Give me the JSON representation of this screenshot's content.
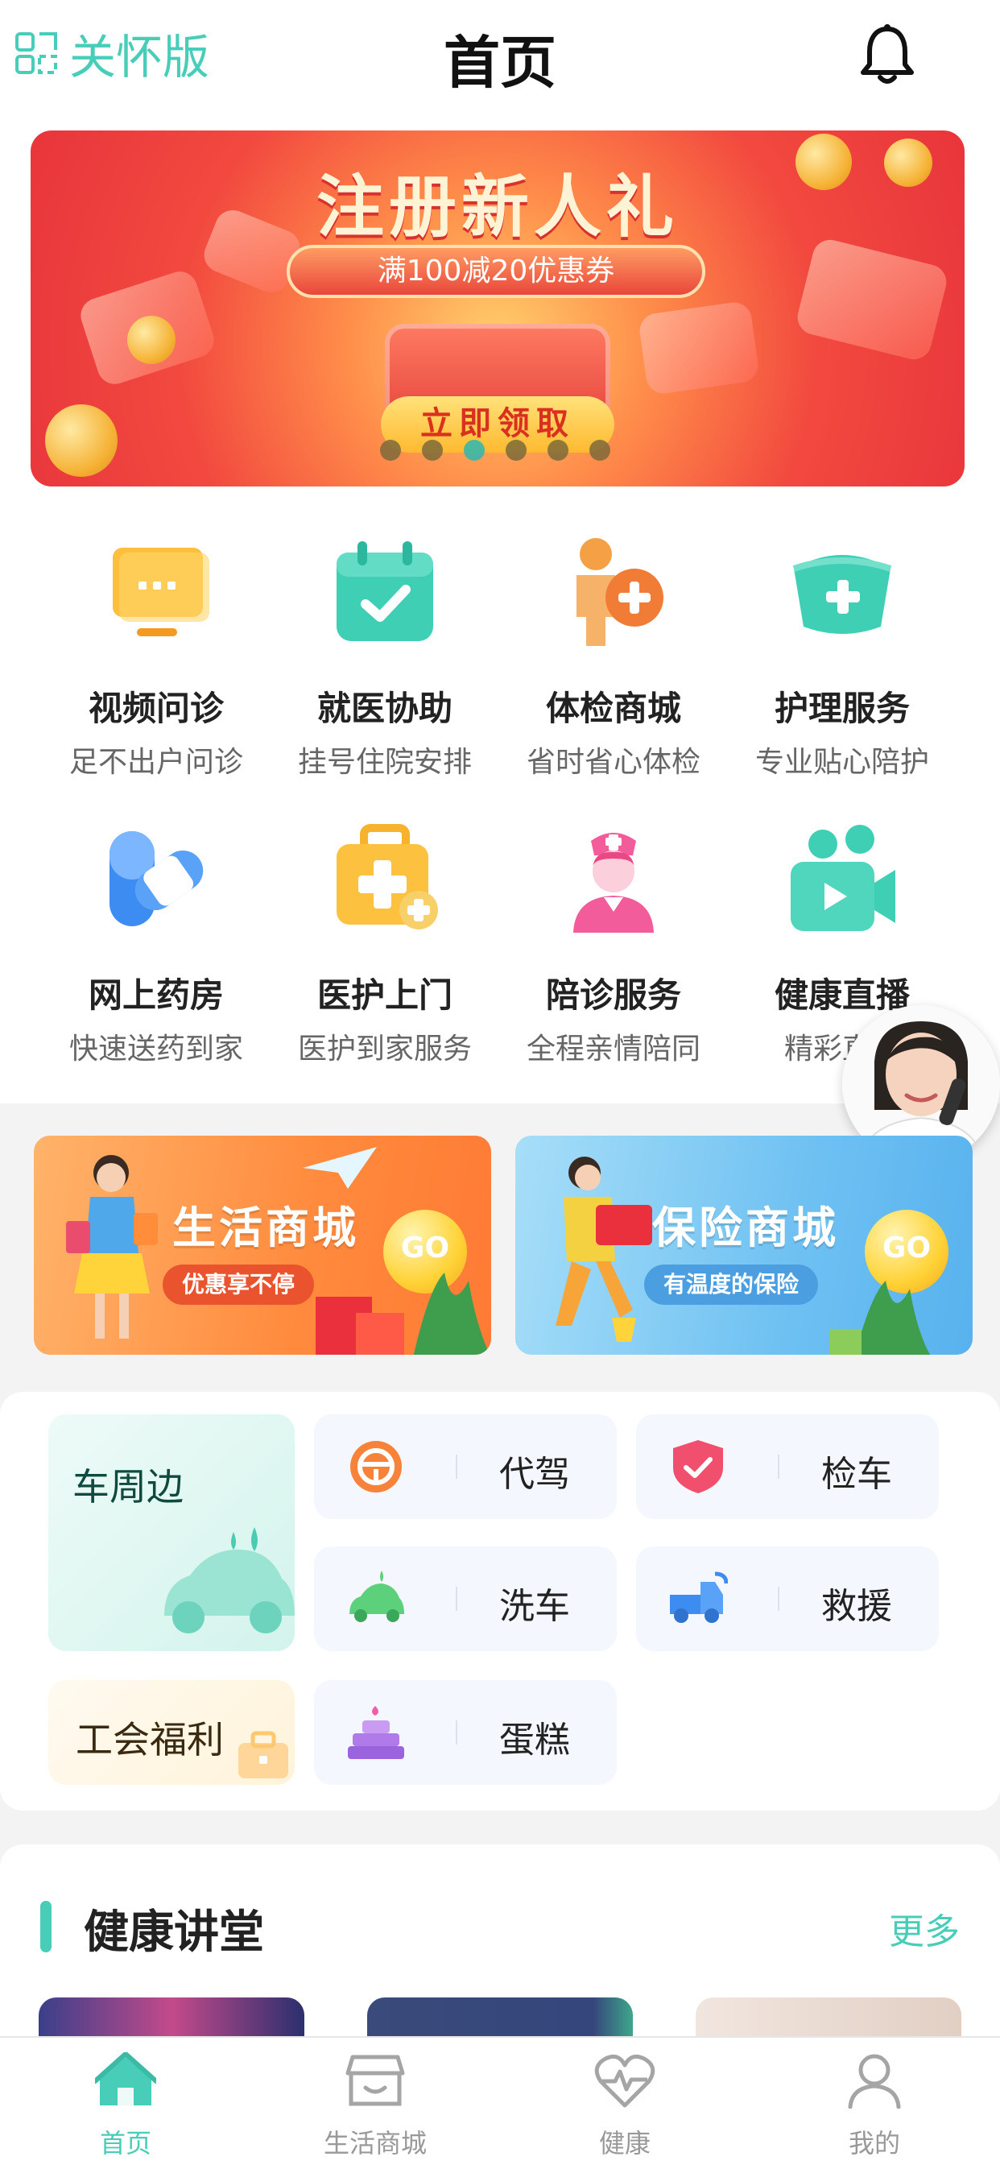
{
  "header": {
    "care_label": "关怀版",
    "title": "首页"
  },
  "banner": {
    "title": "注册新人礼",
    "coupon": "满100减20优惠券",
    "button": "立即领取",
    "pages": 6,
    "active_page": 3
  },
  "services": [
    {
      "name": "视频问诊",
      "sub": "足不出户问诊",
      "icon": "video-consult-icon"
    },
    {
      "name": "就医协助",
      "sub": "挂号住院安排",
      "icon": "calendar-check-icon"
    },
    {
      "name": "体检商城",
      "sub": "省时省心体检",
      "icon": "checkup-icon"
    },
    {
      "name": "护理服务",
      "sub": "专业贴心陪护",
      "icon": "nurse-cap-icon"
    },
    {
      "name": "网上药房",
      "sub": "快速送药到家",
      "icon": "pill-icon"
    },
    {
      "name": "医护上门",
      "sub": "医护到家服务",
      "icon": "medical-kit-icon"
    },
    {
      "name": "陪诊服务",
      "sub": "全程亲情陪同",
      "icon": "nurse-icon"
    },
    {
      "name": "健康直播",
      "sub": "精彩直播",
      "icon": "live-camera-icon"
    }
  ],
  "promos": {
    "life": {
      "title": "生活商城",
      "tag": "优惠享不停",
      "go": "GO"
    },
    "insurance": {
      "title": "保险商城",
      "tag": "有温度的保险",
      "go": "GO"
    }
  },
  "car": {
    "title": "车周边",
    "union": "工会福利",
    "tiles": [
      {
        "label": "代驾",
        "icon": "steering-wheel-icon"
      },
      {
        "label": "检车",
        "icon": "shield-check-icon"
      },
      {
        "label": "洗车",
        "icon": "car-wash-icon"
      },
      {
        "label": "救援",
        "icon": "tow-truck-icon"
      },
      {
        "label": "蛋糕",
        "icon": "cake-icon"
      }
    ]
  },
  "lecture": {
    "title": "健康讲堂",
    "more": "更多"
  },
  "tabs": [
    {
      "label": "首页",
      "active": true
    },
    {
      "label": "生活商城",
      "active": false
    },
    {
      "label": "健康",
      "active": false
    },
    {
      "label": "我的",
      "active": false
    }
  ],
  "colors": {
    "accent": "#48cdb8",
    "banner_red": "#e8353c"
  }
}
